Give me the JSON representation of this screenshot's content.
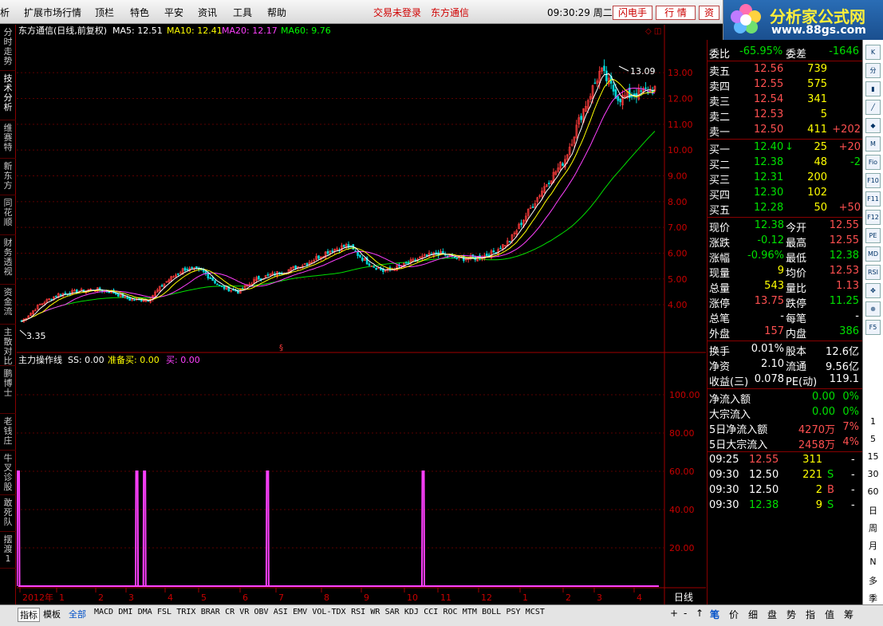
{
  "menu": {
    "items": [
      "析",
      "扩展市场行情",
      "顶栏",
      "特色",
      "平安",
      "资讯",
      "工具",
      "帮助"
    ],
    "status_login": "交易未登录",
    "broker": "东方通信",
    "clock": "09:30:29 周二",
    "btn_flash": "闪电手",
    "btn_quote": "行 情",
    "btn_cap": "资"
  },
  "logo": {
    "title": "分析家公式网",
    "url": "www.88gs.com"
  },
  "left_tabs": [
    {
      "label": "分时走势",
      "active": false
    },
    {
      "label": "技术分析",
      "active": true
    },
    {
      "label": "维赛特",
      "active": false
    },
    {
      "label": "新东方",
      "active": false
    },
    {
      "label": "同花顺",
      "active": false
    },
    {
      "label": "财务透视",
      "active": false
    },
    {
      "label": "资金流",
      "active": false
    },
    {
      "label": "主散对比",
      "active": false
    },
    {
      "label": "鹏博士",
      "active": false
    },
    {
      "label": "老钱庄",
      "active": false
    },
    {
      "label": "牛叉诊股",
      "active": false
    },
    {
      "label": "敢死队",
      "active": false
    },
    {
      "label": "摆渡1",
      "active": false
    }
  ],
  "chart": {
    "title": "东方通信(日线,前复权)",
    "ma_labels": [
      {
        "text": "MA5: 12.51",
        "color": "#ffffff"
      },
      {
        "text": "MA10: 12.41",
        "color": "#ffff00"
      },
      {
        "text": "MA20: 12.17",
        "color": "#ff40ff"
      },
      {
        "text": "MA60: 9.76",
        "color": "#00ff00"
      }
    ],
    "price_axis": [
      "13.00",
      "12.00",
      "11.00",
      "10.00",
      "9.00",
      "8.00",
      "7.00",
      "6.00",
      "5.00",
      "4.00"
    ],
    "high_mark": "13.09",
    "low_mark": "3.35",
    "ind_title": "主力操作线",
    "ind_labels": [
      {
        "text": "SS: 0.00",
        "color": "#ffffff"
      },
      {
        "text": "准备买: 0.00",
        "color": "#ffff00"
      },
      {
        "text": "买: 0.00",
        "color": "#ff40ff"
      }
    ],
    "ind_axis": [
      "100.00",
      "80.00",
      "60.00",
      "40.00",
      "20.00"
    ],
    "date_labels": [
      "2012年",
      "1",
      "2",
      "3",
      "4",
      "5",
      "6",
      "7",
      "8",
      "9",
      "10",
      "11",
      "12",
      "1",
      "2",
      "3",
      "4"
    ],
    "period": "日线",
    "corner": "◇ ◫"
  },
  "chart_data": {
    "type": "candlestick",
    "ylim": [
      3.2,
      13.5
    ],
    "ma_last": {
      "MA5": 12.51,
      "MA10": 12.41,
      "MA20": 12.17,
      "MA60": 9.76
    },
    "close_path": [
      3.35,
      4.0,
      4.4,
      4.5,
      4.6,
      4.5,
      4.2,
      4.2,
      4.9,
      5.4,
      5.3,
      4.7,
      4.5,
      5.0,
      5.2,
      5.4,
      5.7,
      6.1,
      6.3,
      5.7,
      5.3,
      5.5,
      5.8,
      6.0,
      5.8,
      5.8,
      6.0,
      6.5,
      7.6,
      8.7,
      9.6,
      11.5,
      13.09,
      12.0,
      12.2,
      12.38
    ],
    "indicator": {
      "ylim": [
        0,
        100
      ],
      "spikes": [
        {
          "pos": 0.0,
          "value": 60
        },
        {
          "pos": 0.185,
          "value": 60
        },
        {
          "pos": 0.197,
          "value": 60
        },
        {
          "pos": 0.389,
          "value": 60
        },
        {
          "pos": 0.632,
          "value": 60
        }
      ]
    }
  },
  "panel": {
    "weibi": {
      "label": "委比",
      "value": "-65.95%",
      "diff_label": "委差",
      "diff": "-1646"
    },
    "sells": [
      {
        "label": "卖五",
        "price": "12.56",
        "vol": "739",
        "chg": ""
      },
      {
        "label": "卖四",
        "price": "12.55",
        "vol": "575",
        "chg": ""
      },
      {
        "label": "卖三",
        "price": "12.54",
        "vol": "341",
        "chg": ""
      },
      {
        "label": "卖二",
        "price": "12.53",
        "vol": "5",
        "chg": ""
      },
      {
        "label": "卖一",
        "price": "12.50",
        "vol": "411",
        "chg": "+202"
      }
    ],
    "buys": [
      {
        "label": "买一",
        "price": "12.40",
        "arrow": "↓",
        "vol": "25",
        "chg": "+20"
      },
      {
        "label": "买二",
        "price": "12.38",
        "arrow": "",
        "vol": "48",
        "chg": "-2"
      },
      {
        "label": "买三",
        "price": "12.31",
        "arrow": "",
        "vol": "200",
        "chg": ""
      },
      {
        "label": "买四",
        "price": "12.30",
        "arrow": "",
        "vol": "102",
        "chg": ""
      },
      {
        "label": "买五",
        "price": "12.28",
        "arrow": "",
        "vol": "50",
        "chg": "+50"
      }
    ],
    "quote": [
      {
        "l1": "现价",
        "v1": "12.38",
        "c1": "g",
        "l2": "今开",
        "v2": "12.55",
        "c2": "r"
      },
      {
        "l1": "涨跌",
        "v1": "-0.12",
        "c1": "g",
        "l2": "最高",
        "v2": "12.55",
        "c2": "r"
      },
      {
        "l1": "涨幅",
        "v1": "-0.96%",
        "c1": "g",
        "l2": "最低",
        "v2": "12.38",
        "c2": "g"
      },
      {
        "l1": "现量",
        "v1": "9",
        "c1": "y",
        "l2": "均价",
        "v2": "12.53",
        "c2": "r"
      },
      {
        "l1": "总量",
        "v1": "543",
        "c1": "y",
        "l2": "量比",
        "v2": "1.13",
        "c2": "r"
      },
      {
        "l1": "涨停",
        "v1": "13.75",
        "c1": "r",
        "l2": "跌停",
        "v2": "11.25",
        "c2": "g"
      },
      {
        "l1": "总笔",
        "v1": "-",
        "c1": "w",
        "l2": "每笔",
        "v2": "-",
        "c2": "w"
      },
      {
        "l1": "外盘",
        "v1": "157",
        "c1": "r",
        "l2": "内盘",
        "v2": "386",
        "c2": "g"
      }
    ],
    "fund": [
      {
        "l1": "换手",
        "v1": "0.01%",
        "l2": "股本",
        "v2": "12.6亿"
      },
      {
        "l1": "净资",
        "v1": "2.10",
        "l2": "流通",
        "v2": "9.56亿"
      },
      {
        "l1": "收益(三)",
        "v1": "0.078",
        "l2": "PE(动)",
        "v2": "119.1"
      }
    ],
    "flows": [
      {
        "label": "净流入额",
        "value": "0.00",
        "pct": "0%",
        "color": "g"
      },
      {
        "label": "大宗流入",
        "value": "0.00",
        "pct": "0%",
        "color": "g"
      },
      {
        "label": "5日净流入额",
        "value": "4270万",
        "pct": "7%",
        "color": "r"
      },
      {
        "label": "5日大宗流入",
        "value": "2458万",
        "pct": "4%",
        "color": "r"
      }
    ],
    "ticks": [
      {
        "time": "09:25",
        "price": "12.55",
        "pc": "r",
        "vol": "311",
        "side": "",
        "sc": "w",
        "dash": "-"
      },
      {
        "time": "09:30",
        "price": "12.50",
        "pc": "w",
        "vol": "221",
        "side": "S",
        "sc": "g",
        "dash": "-"
      },
      {
        "time": "09:30",
        "price": "12.50",
        "pc": "w",
        "vol": "2",
        "side": "B",
        "sc": "r",
        "dash": "-"
      },
      {
        "time": "09:30",
        "price": "12.38",
        "pc": "g",
        "vol": "9",
        "side": "S",
        "sc": "g",
        "dash": "-"
      }
    ]
  },
  "right_toolbar": {
    "icons": [
      "kline-icon",
      "minute-icon",
      "bar-icon",
      "line-icon",
      "candle-icon",
      "ma-icon",
      "fio-icon",
      "f10-icon",
      "f11-icon",
      "f12-icon",
      "pe-icon",
      "macd-icon",
      "rsi-icon",
      "arrows-icon",
      "zoom-icon",
      "f5-icon"
    ],
    "icon_labels": [
      "K",
      "分",
      "▮",
      "╱",
      "◆",
      "M",
      "Fio",
      "F10",
      "F11",
      "F12",
      "PE",
      "MD",
      "RSI",
      "✥",
      "⊕",
      "F5"
    ],
    "periods": [
      "1",
      "5",
      "15",
      "30",
      "60",
      "日",
      "周",
      "月",
      "N",
      "多",
      "季"
    ]
  },
  "bottom_tabs": [
    "指标",
    "模板",
    "全部",
    "MACD",
    "DMI",
    "DMA",
    "FSL",
    "TRIX",
    "BRAR",
    "CR",
    "VR",
    "OBV",
    "ASI",
    "EMV",
    "VOL-TDX",
    "RSI",
    "WR",
    "SAR",
    "KDJ",
    "CCI",
    "ROC",
    "MTM",
    "BOLL",
    "PSY",
    "MCST"
  ],
  "bottom_nav": [
    "+",
    "-",
    "↑"
  ],
  "panel_tabs": [
    "笔",
    "价",
    "细",
    "盘",
    "势",
    "指",
    "值",
    "筹"
  ]
}
